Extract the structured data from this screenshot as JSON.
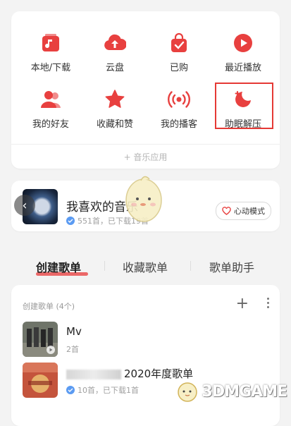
{
  "apps": [
    {
      "label": "本地/下载",
      "icon": "download-folder-icon"
    },
    {
      "label": "云盘",
      "icon": "cloud-upload-icon"
    },
    {
      "label": "已购",
      "icon": "shopping-bag-icon"
    },
    {
      "label": "最近播放",
      "icon": "play-icon"
    },
    {
      "label": "我的好友",
      "icon": "friends-icon"
    },
    {
      "label": "收藏和赞",
      "icon": "star-icon"
    },
    {
      "label": "我的播客",
      "icon": "podcast-icon"
    },
    {
      "label": "助眠解压",
      "icon": "moon-icon"
    }
  ],
  "music_apps": "+ 音乐应用",
  "favorite": {
    "title": "我喜欢的音乐",
    "subtitle": "551首，已下载19首",
    "heart_mode": "心动模式"
  },
  "tabs": [
    "创建歌单",
    "收藏歌单",
    "歌单助手"
  ],
  "list": {
    "header": "创建歌单 (4个)",
    "items": [
      {
        "title": "Mv",
        "subtitle": "2首"
      },
      {
        "title": "2020年度歌单",
        "subtitle": "10首，已下载1首"
      }
    ]
  },
  "watermark": "3DMGAME",
  "colors": {
    "accent": "#e8403f",
    "check": "#5b9bf2"
  }
}
